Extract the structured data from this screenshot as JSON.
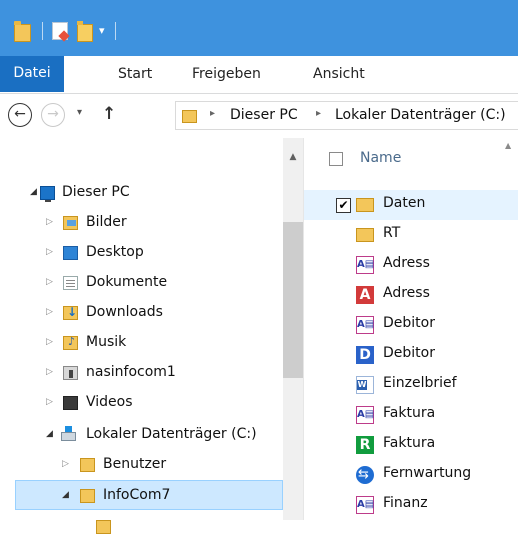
{
  "ribbon": {
    "tabs": [
      "Datei",
      "Start",
      "Freigeben",
      "Ansicht"
    ]
  },
  "quick_access": {
    "dropdown_glyph": "▾"
  },
  "address": {
    "back_glyph": "←",
    "forward_glyph": "→",
    "history_glyph": "▾",
    "up_glyph": "↑",
    "breadcrumbs": [
      "Dieser PC",
      "Lokaler Datenträger (C:)"
    ],
    "separator": "▸"
  },
  "tree": {
    "items": [
      {
        "label": "Dieser PC",
        "icon": "this-pc-icon",
        "twist": "◢"
      },
      {
        "label": "Bilder",
        "icon": "pictures-folder-icon",
        "twist": "▷"
      },
      {
        "label": "Desktop",
        "icon": "desktop-folder-icon",
        "twist": "▷"
      },
      {
        "label": "Dokumente",
        "icon": "documents-folder-icon",
        "twist": "▷"
      },
      {
        "label": "Downloads",
        "icon": "downloads-folder-icon",
        "twist": "▷"
      },
      {
        "label": "Musik",
        "icon": "music-folder-icon",
        "twist": "▷"
      },
      {
        "label": "nasinfocom1",
        "icon": "network-device-icon",
        "twist": "▷"
      },
      {
        "label": "Videos",
        "icon": "videos-folder-icon",
        "twist": "▷"
      },
      {
        "label": "Lokaler Datenträger (C:)",
        "icon": "local-drive-icon",
        "twist": "◢"
      },
      {
        "label": "Benutzer",
        "icon": "folder-icon",
        "twist": "▷"
      },
      {
        "label": "InfoCom7",
        "icon": "folder-icon",
        "twist": "◢"
      }
    ],
    "scroll_up_glyph": "▲"
  },
  "files": {
    "column_name": "Name",
    "sort_glyph": "▲",
    "items": [
      {
        "label": "Daten",
        "icon": "folder-icon",
        "checked": "✔"
      },
      {
        "label": "RT",
        "icon": "folder-icon"
      },
      {
        "label": "Adress",
        "icon": "access-database-icon",
        "glyph": "A▤"
      },
      {
        "label": "Adress",
        "icon": "red-a-app-icon",
        "glyph": "A"
      },
      {
        "label": "Debitor",
        "icon": "access-database-icon",
        "glyph": "A▤"
      },
      {
        "label": "Debitor",
        "icon": "blue-d-app-icon",
        "glyph": "D"
      },
      {
        "label": "Einzelbrief",
        "icon": "word-document-icon"
      },
      {
        "label": "Faktura",
        "icon": "access-database-icon",
        "glyph": "A▤"
      },
      {
        "label": "Faktura",
        "icon": "green-r-app-icon",
        "glyph": "R"
      },
      {
        "label": "Fernwartung",
        "icon": "teamviewer-icon"
      },
      {
        "label": "Finanz",
        "icon": "access-database-icon",
        "glyph": "A▤"
      }
    ]
  },
  "colors": {
    "titlebar": "#3e92de",
    "file_tab": "#1a6fc2",
    "selection": "#cde8ff",
    "hover_row": "#e5f3ff"
  }
}
